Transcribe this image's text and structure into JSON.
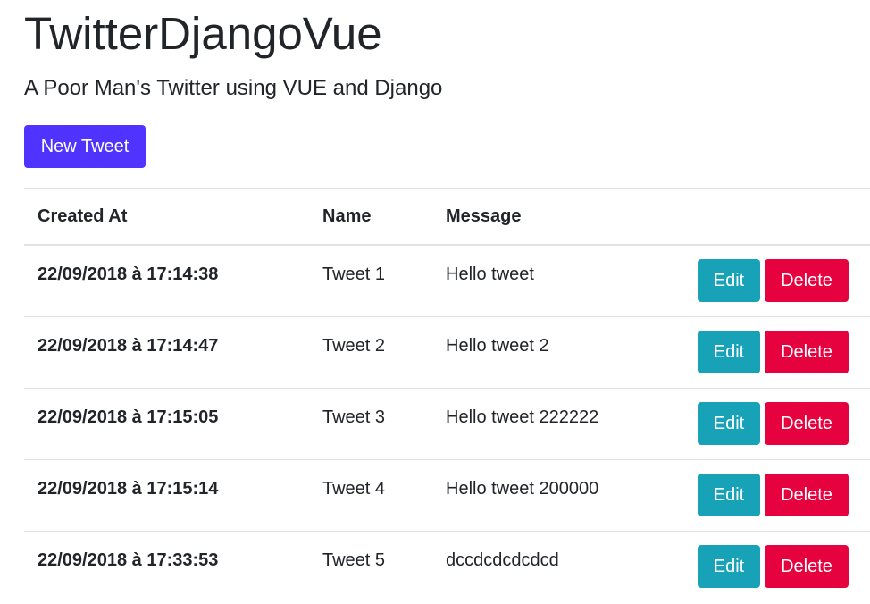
{
  "header": {
    "title": "TwitterDjangoVue",
    "subtitle": "A Poor Man's Twitter using VUE and Django"
  },
  "toolbar": {
    "new_tweet_label": "New Tweet"
  },
  "table": {
    "columns": [
      "Created At",
      "Name",
      "Message",
      ""
    ],
    "edit_label": "Edit",
    "delete_label": "Delete",
    "rows": [
      {
        "created_at": "22/09/2018 à 17:14:38",
        "name": "Tweet 1",
        "message": "Hello tweet"
      },
      {
        "created_at": "22/09/2018 à 17:14:47",
        "name": "Tweet 2",
        "message": "Hello tweet 2"
      },
      {
        "created_at": "22/09/2018 à 17:15:05",
        "name": "Tweet 3",
        "message": "Hello tweet 222222"
      },
      {
        "created_at": "22/09/2018 à 17:15:14",
        "name": "Tweet 4",
        "message": "Hello tweet 200000"
      },
      {
        "created_at": "22/09/2018 à 17:33:53",
        "name": "Tweet 5",
        "message": "dccdcdcdcdcd"
      }
    ]
  },
  "colors": {
    "primary": "#5033ff",
    "info": "#17a2b8",
    "danger": "#e6023f",
    "text": "#212529",
    "border": "#dee2e6"
  }
}
